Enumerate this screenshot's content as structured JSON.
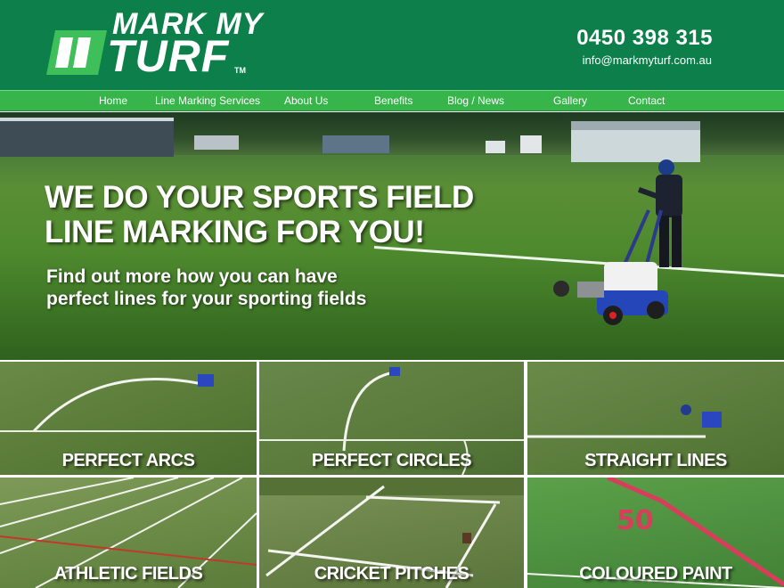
{
  "header": {
    "logo_line1": "MARK MY",
    "logo_line2": "TURF",
    "logo_tm": "TM",
    "phone": "0450 398 315",
    "email": "info@markmyturf.com.au"
  },
  "nav": {
    "items": [
      {
        "label": "Home"
      },
      {
        "label": "Line Marking Services"
      },
      {
        "label": "About Us"
      },
      {
        "label": "Benefits"
      },
      {
        "label": "Blog / News"
      },
      {
        "label": "Gallery"
      },
      {
        "label": "Contact"
      }
    ]
  },
  "hero": {
    "title_line1": "WE DO YOUR SPORTS FIELD",
    "title_line2": "LINE MARKING FOR YOU!",
    "subtitle_line1": "Find out more how you can have",
    "subtitle_line2": "perfect lines for your sporting fields"
  },
  "tiles": [
    {
      "label": "PERFECT ARCS"
    },
    {
      "label": "PERFECT CIRCLES"
    },
    {
      "label": "STRAIGHT LINES"
    },
    {
      "label": "ATHLETIC FIELDS"
    },
    {
      "label": "CRICKET PITCHES"
    },
    {
      "label": "COLOURED PAINT"
    }
  ],
  "colors": {
    "header_bg": "#0c7f4a",
    "nav_bg": "#37b44a"
  }
}
